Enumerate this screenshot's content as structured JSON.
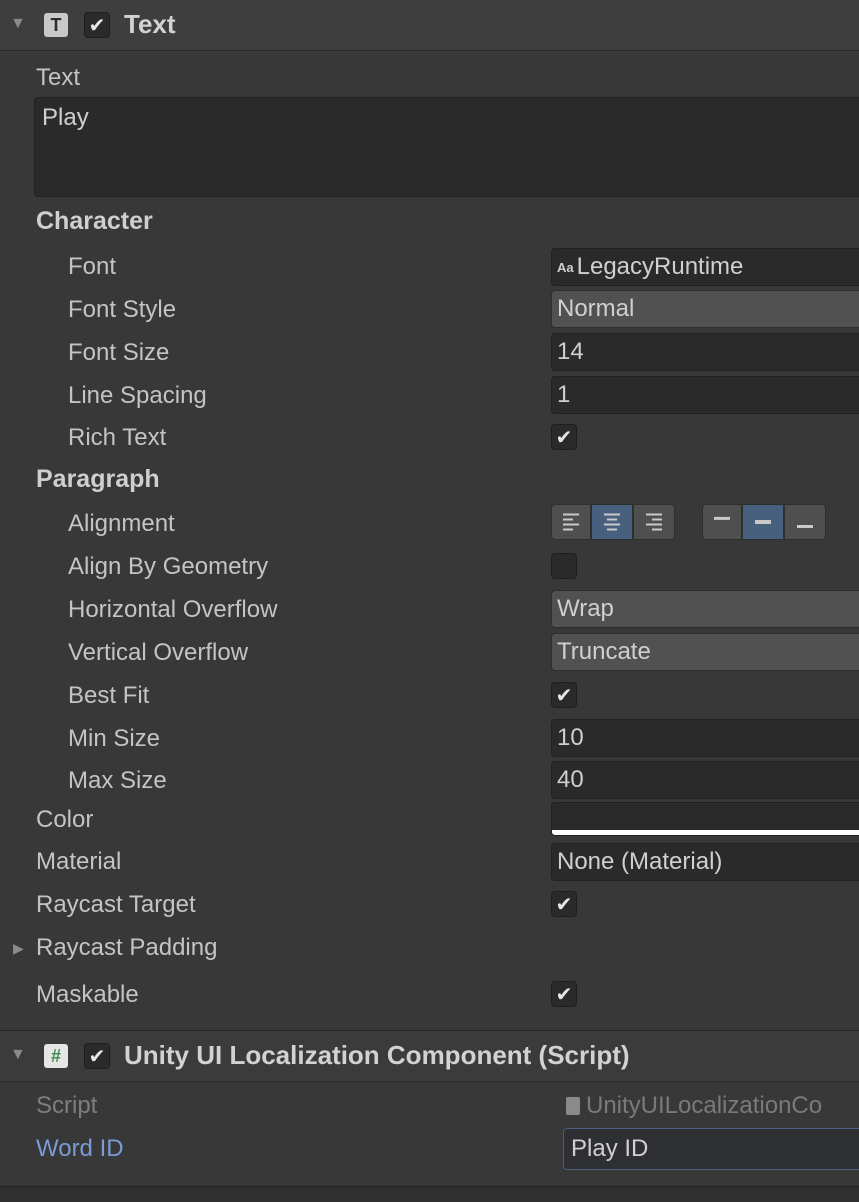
{
  "text_component": {
    "title": "Text",
    "icon_glyph": "T",
    "enabled_glyph": "✔",
    "fold_glyph": "▼",
    "text_label": "Text",
    "text_value": "Play",
    "character": {
      "header": "Character",
      "font_label": "Font",
      "font_icon": "Aa",
      "font_value": "LegacyRuntime",
      "font_style_label": "Font Style",
      "font_style_value": "Normal",
      "font_size_label": "Font Size",
      "font_size_value": "14",
      "line_spacing_label": "Line Spacing",
      "line_spacing_value": "1",
      "rich_text_label": "Rich Text",
      "rich_text_checked": true
    },
    "paragraph": {
      "header": "Paragraph",
      "alignment_label": "Alignment",
      "horizontal_alignment_selected": "center",
      "vertical_alignment_selected": "middle",
      "align_by_geometry_label": "Align By Geometry",
      "align_by_geometry_checked": false,
      "horizontal_overflow_label": "Horizontal Overflow",
      "horizontal_overflow_value": "Wrap",
      "vertical_overflow_label": "Vertical Overflow",
      "vertical_overflow_value": "Truncate",
      "best_fit_label": "Best Fit",
      "best_fit_checked": true,
      "min_size_label": "Min Size",
      "min_size_value": "10",
      "max_size_label": "Max Size",
      "max_size_value": "40"
    },
    "color_label": "Color",
    "color_value": "#ffffff",
    "material_label": "Material",
    "material_value": "None (Material)",
    "raycast_target_label": "Raycast Target",
    "raycast_target_checked": true,
    "raycast_padding_label": "Raycast Padding",
    "raycast_padding_fold": "▶",
    "maskable_label": "Maskable",
    "maskable_checked": true
  },
  "localization_component": {
    "title": "Unity UI Localization Component (Script)",
    "icon_glyph": "#",
    "enabled_glyph": "✔",
    "fold_glyph": "▼",
    "script_label": "Script",
    "script_value": "UnityUILocalizationCo",
    "word_id_label": "Word ID",
    "word_id_value": "Play ID"
  },
  "colors": {
    "background": "#383838",
    "field": "#2a2a2a",
    "dropdown": "#515151",
    "selected_segment": "#46607e",
    "link_label": "#7c9bd3"
  }
}
